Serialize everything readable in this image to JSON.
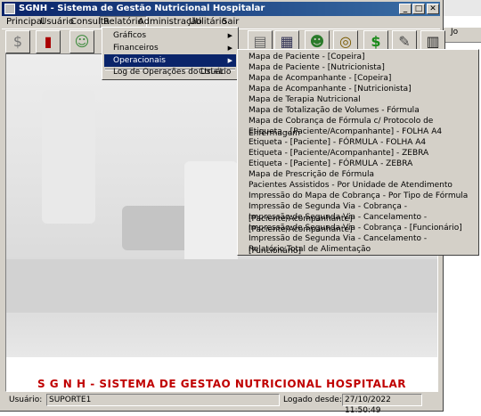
{
  "window": {
    "title": "SGNH - Sistema de Gestão Nutricional Hospitalar"
  },
  "window_buttons": {
    "minimize": "_",
    "maximize": "□",
    "close": "✕"
  },
  "menubar": [
    "Principal",
    "Usuário",
    "Consulta",
    "Relatório",
    "Administração",
    "Utilitário",
    "Sair"
  ],
  "relatorio_menu": {
    "items": [
      "Gráficos",
      "Financeiros",
      "Operacionais"
    ],
    "log_label": "Log de Operações do Usuário",
    "log_shortcut": "Ctrl+L"
  },
  "operacionais_submenu": [
    "Mapa de Paciente - [Copeira]",
    "Mapa de Paciente - [Nutricionista]",
    "Mapa de Acompanhante - [Copeira]",
    "Mapa de Acompanhante - [Nutricionista]",
    "Mapa de Terapia Nutricional",
    "Mapa de Totalização de Volumes - Fórmula",
    "Mapa de Cobrança de Fórmula c/ Protocolo de Enfermagem",
    "Etiqueta - [Paciente/Acompanhante] - FOLHA A4",
    "Etiqueta - [Paciente] - FÓRMULA - FOLHA A4",
    "Etiqueta - [Paciente/Acompanhante] - ZEBRA",
    "Etiqueta - [Paciente] - FÓRMULA - ZEBRA",
    "Mapa de Prescrição de Fórmula",
    "Pacientes Assistidos - Por Unidade de Atendimento",
    "Impressão do Mapa de Cobrança - Por Tipo de Fórmula",
    "Impressão de Segunda Via - Cobrança - [Paciente/Acompanhante]",
    "Impressão de Segunda Via - Cancelamento - [Paciente/Acompanhante]",
    "Impressão de Segunda Via - Cobrança - [Funcionário]",
    "Impressão de Segunda Via - Cancelamento - [Funcionário]",
    "Relatório Total de Alimentação"
  ],
  "banner": {
    "text": "S G N H  - SISTEMA DE GESTAO NUTRICIONAL HOSPITALAR"
  },
  "statusbar": {
    "user_label": "Usuário:",
    "user_value": "SUPORTE1",
    "logged_label": "Logado desde:",
    "logged_value": "27/10/2022  11:50:49"
  },
  "outer_toolbar_text": "Jo",
  "toolbar_icons": [
    "dollar-sign-icon",
    "book-icon",
    "user-icon",
    "coins-icon",
    "dollar-icon",
    "document-icon",
    "calculator-icon"
  ],
  "colors": {
    "title_start": "#0a246a",
    "title_end": "#3a6ea5",
    "highlight": "#0a246a",
    "banner_text": "#c00000"
  }
}
